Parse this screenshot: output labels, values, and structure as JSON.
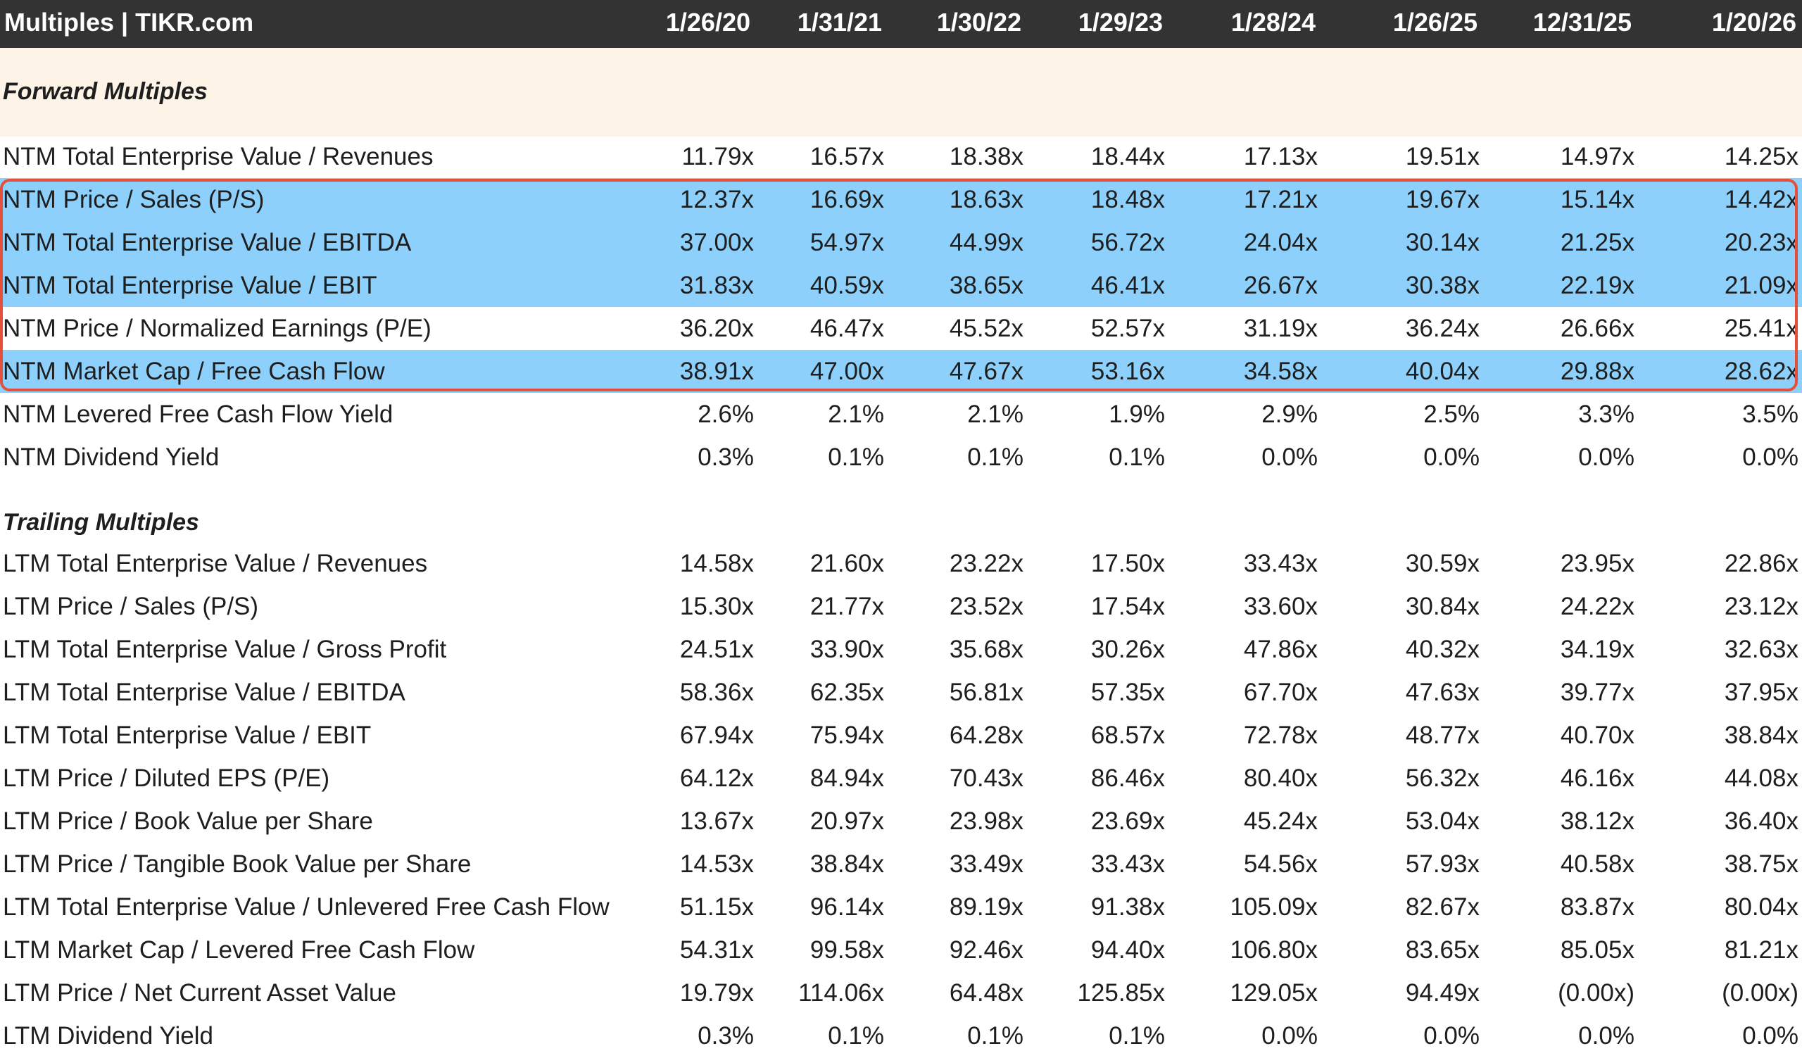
{
  "header": {
    "title": "Multiples | TIKR.com",
    "dates": [
      "1/26/20",
      "1/31/21",
      "1/30/22",
      "1/29/23",
      "1/28/24",
      "1/26/25",
      "12/31/25",
      "1/20/26"
    ]
  },
  "colors": {
    "header_bg": "#333333",
    "section_band_bg": "#fdf3e7",
    "highlight_row_bg": "#8cd0fb",
    "highlight_border": "#e6503a"
  },
  "forward": {
    "title": "Forward Multiples",
    "rows": [
      {
        "label": "NTM Total Enterprise Value / Revenues",
        "highlighted": false,
        "values": [
          "11.79x",
          "16.57x",
          "18.38x",
          "18.44x",
          "17.13x",
          "19.51x",
          "14.97x",
          "14.25x"
        ]
      },
      {
        "label": "NTM Price / Sales (P/S)",
        "highlighted": true,
        "values": [
          "12.37x",
          "16.69x",
          "18.63x",
          "18.48x",
          "17.21x",
          "19.67x",
          "15.14x",
          "14.42x"
        ]
      },
      {
        "label": "NTM Total Enterprise Value / EBITDA",
        "highlighted": true,
        "values": [
          "37.00x",
          "54.97x",
          "44.99x",
          "56.72x",
          "24.04x",
          "30.14x",
          "21.25x",
          "20.23x"
        ]
      },
      {
        "label": "NTM Total Enterprise Value / EBIT",
        "highlighted": true,
        "values": [
          "31.83x",
          "40.59x",
          "38.65x",
          "46.41x",
          "26.67x",
          "30.38x",
          "22.19x",
          "21.09x"
        ]
      },
      {
        "label": "NTM Price / Normalized Earnings (P/E)",
        "highlighted": false,
        "values": [
          "36.20x",
          "46.47x",
          "45.52x",
          "52.57x",
          "31.19x",
          "36.24x",
          "26.66x",
          "25.41x"
        ]
      },
      {
        "label": "NTM Market Cap / Free Cash Flow",
        "highlighted": true,
        "values": [
          "38.91x",
          "47.00x",
          "47.67x",
          "53.16x",
          "34.58x",
          "40.04x",
          "29.88x",
          "28.62x"
        ]
      },
      {
        "label": "NTM Levered Free Cash Flow Yield",
        "highlighted": false,
        "values": [
          "2.6%",
          "2.1%",
          "2.1%",
          "1.9%",
          "2.9%",
          "2.5%",
          "3.3%",
          "3.5%"
        ]
      },
      {
        "label": "NTM Dividend Yield",
        "highlighted": false,
        "values": [
          "0.3%",
          "0.1%",
          "0.1%",
          "0.1%",
          "0.0%",
          "0.0%",
          "0.0%",
          "0.0%"
        ]
      }
    ]
  },
  "trailing": {
    "title": "Trailing Multiples",
    "rows": [
      {
        "label": "LTM Total Enterprise Value / Revenues",
        "values": [
          "14.58x",
          "21.60x",
          "23.22x",
          "17.50x",
          "33.43x",
          "30.59x",
          "23.95x",
          "22.86x"
        ]
      },
      {
        "label": "LTM Price / Sales (P/S)",
        "values": [
          "15.30x",
          "21.77x",
          "23.52x",
          "17.54x",
          "33.60x",
          "30.84x",
          "24.22x",
          "23.12x"
        ]
      },
      {
        "label": "LTM Total Enterprise Value / Gross Profit",
        "values": [
          "24.51x",
          "33.90x",
          "35.68x",
          "30.26x",
          "47.86x",
          "40.32x",
          "34.19x",
          "32.63x"
        ]
      },
      {
        "label": "LTM Total Enterprise Value / EBITDA",
        "values": [
          "58.36x",
          "62.35x",
          "56.81x",
          "57.35x",
          "67.70x",
          "47.63x",
          "39.77x",
          "37.95x"
        ]
      },
      {
        "label": "LTM Total Enterprise Value / EBIT",
        "values": [
          "67.94x",
          "75.94x",
          "64.28x",
          "68.57x",
          "72.78x",
          "48.77x",
          "40.70x",
          "38.84x"
        ]
      },
      {
        "label": "LTM Price / Diluted EPS (P/E)",
        "values": [
          "64.12x",
          "84.94x",
          "70.43x",
          "86.46x",
          "80.40x",
          "56.32x",
          "46.16x",
          "44.08x"
        ]
      },
      {
        "label": "LTM Price / Book Value per Share",
        "values": [
          "13.67x",
          "20.97x",
          "23.98x",
          "23.69x",
          "45.24x",
          "53.04x",
          "38.12x",
          "36.40x"
        ]
      },
      {
        "label": "LTM Price / Tangible Book Value per Share",
        "values": [
          "14.53x",
          "38.84x",
          "33.49x",
          "33.43x",
          "54.56x",
          "57.93x",
          "40.58x",
          "38.75x"
        ]
      },
      {
        "label": "LTM Total Enterprise Value / Unlevered Free Cash Flow",
        "values": [
          "51.15x",
          "96.14x",
          "89.19x",
          "91.38x",
          "105.09x",
          "82.67x",
          "83.87x",
          "80.04x"
        ]
      },
      {
        "label": "LTM Market Cap / Levered Free Cash Flow",
        "values": [
          "54.31x",
          "99.58x",
          "92.46x",
          "94.40x",
          "106.80x",
          "83.65x",
          "85.05x",
          "81.21x"
        ]
      },
      {
        "label": "LTM Price / Net Current Asset Value",
        "values": [
          "19.79x",
          "114.06x",
          "64.48x",
          "125.85x",
          "129.05x",
          "94.49x",
          "(0.00x)",
          "(0.00x)"
        ]
      },
      {
        "label": "LTM Dividend Yield",
        "values": [
          "0.3%",
          "0.1%",
          "0.1%",
          "0.1%",
          "0.0%",
          "0.0%",
          "0.0%",
          "0.0%"
        ]
      }
    ]
  }
}
